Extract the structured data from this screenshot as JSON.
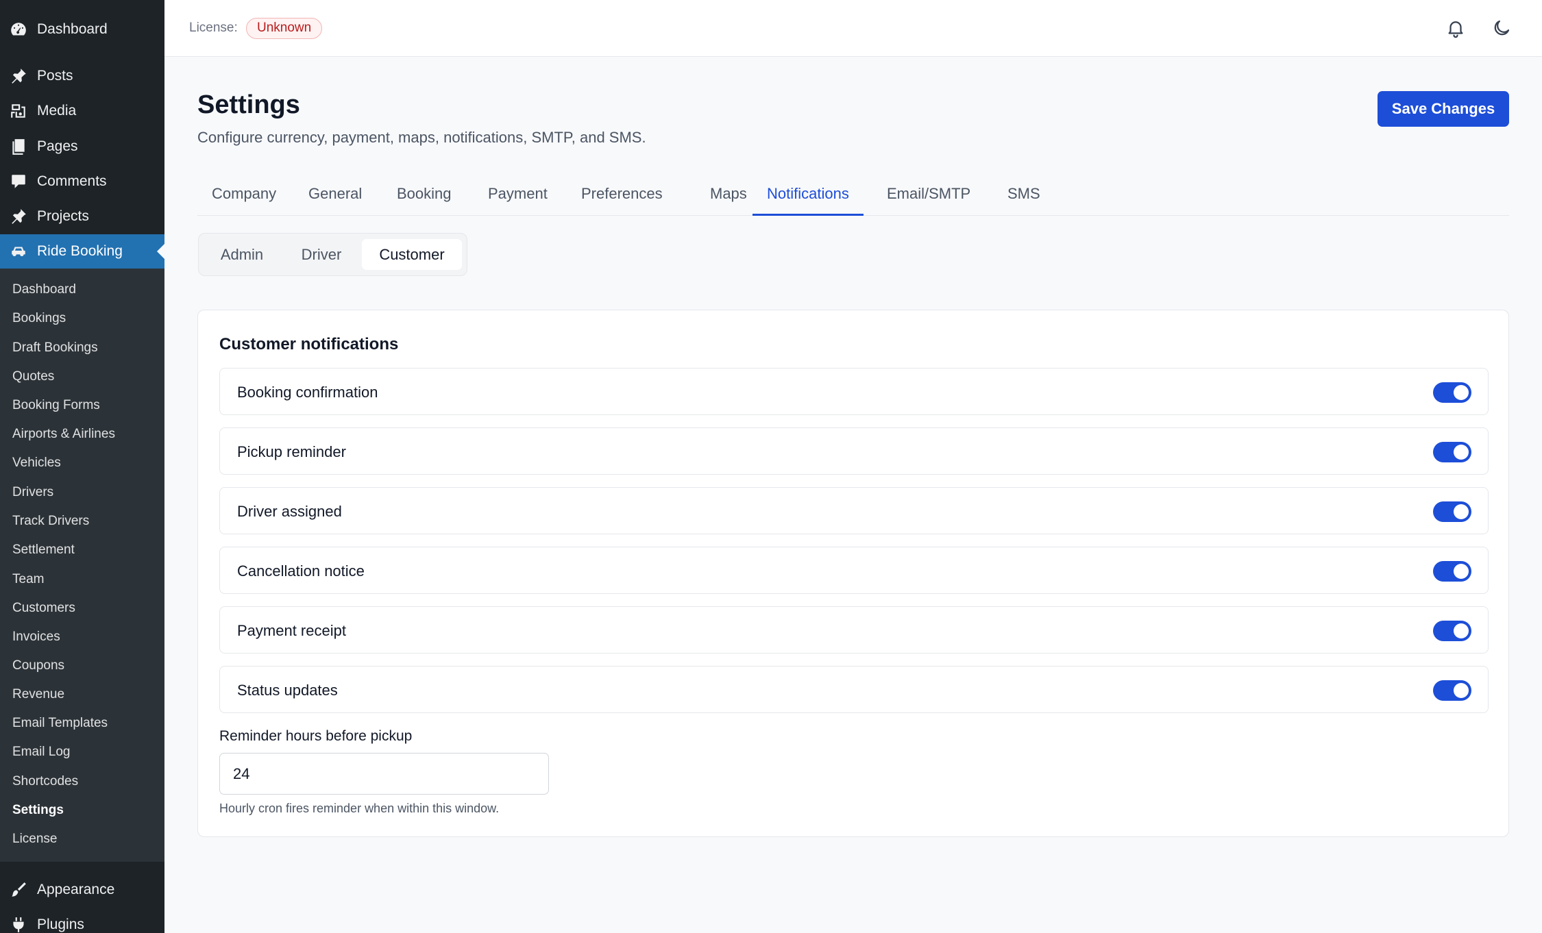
{
  "sidebar": {
    "top_items": [
      {
        "label": "Dashboard",
        "icon": "dashboard-icon"
      },
      {
        "label": "Posts",
        "icon": "pushpin-icon"
      },
      {
        "label": "Media",
        "icon": "media-icon"
      },
      {
        "label": "Pages",
        "icon": "pages-icon"
      },
      {
        "label": "Comments",
        "icon": "comments-icon"
      },
      {
        "label": "Projects",
        "icon": "pushpin-icon"
      },
      {
        "label": "Ride Booking",
        "icon": "car-icon",
        "active": true
      }
    ],
    "sub_items": [
      "Dashboard",
      "Bookings",
      "Draft Bookings",
      "Quotes",
      "Booking Forms",
      "Airports & Airlines",
      "Vehicles",
      "Drivers",
      "Track Drivers",
      "Settlement",
      "Team",
      "Customers",
      "Invoices",
      "Coupons",
      "Revenue",
      "Email Templates",
      "Email Log",
      "Shortcodes",
      "Settings",
      "License"
    ],
    "current_sub_item": "Settings",
    "bottom_items": [
      {
        "label": "Appearance",
        "icon": "brush-icon"
      },
      {
        "label": "Plugins",
        "icon": "plug-icon"
      }
    ]
  },
  "topbar": {
    "license_label": "License:",
    "license_status": "Unknown",
    "icons": [
      "bell-icon",
      "moon-icon"
    ]
  },
  "header": {
    "title": "Settings",
    "subtitle": "Configure currency, payment, maps, notifications, SMTP, and SMS.",
    "save_label": "Save Changes"
  },
  "tabs": {
    "items": [
      "Company",
      "General",
      "Booking",
      "Payment",
      "Preferences",
      "Maps",
      "Notifications",
      "Email/SMTP",
      "SMS"
    ],
    "active": "Notifications"
  },
  "subtabs": {
    "items": [
      "Admin",
      "Driver",
      "Customer"
    ],
    "active": "Customer"
  },
  "card": {
    "title": "Customer notifications",
    "notifications": [
      {
        "label": "Booking confirmation",
        "enabled": true
      },
      {
        "label": "Pickup reminder",
        "enabled": true
      },
      {
        "label": "Driver assigned",
        "enabled": true
      },
      {
        "label": "Cancellation notice",
        "enabled": true
      },
      {
        "label": "Payment receipt",
        "enabled": true
      },
      {
        "label": "Status updates",
        "enabled": true
      }
    ],
    "reminder": {
      "label": "Reminder hours before pickup",
      "value": "24",
      "help": "Hourly cron fires reminder when within this window."
    }
  },
  "colors": {
    "accent": "#1d4ed8",
    "sidebar_bg": "#1d2327",
    "submenu_bg": "#2c3338",
    "sidebar_active": "#2271b1",
    "badge_text": "#b91c1c"
  }
}
